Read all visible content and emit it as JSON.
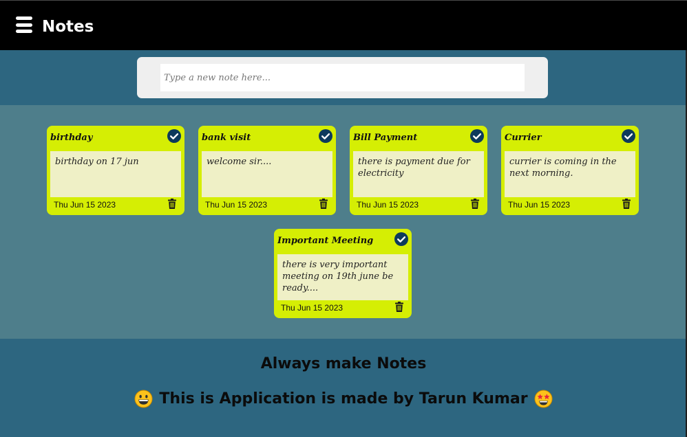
{
  "navbar": {
    "menu_icon": "hamburger-menu-icon",
    "title": "Notes"
  },
  "compose": {
    "placeholder": "Type a new note here...",
    "value": ""
  },
  "notes": [
    {
      "title": "birthday",
      "body": "birthday on 17 jun",
      "date": "Thu Jun 15 2023",
      "done_icon": "check-circle-icon",
      "delete_icon": "trash-icon"
    },
    {
      "title": "bank visit",
      "body": "welcome sir....",
      "date": "Thu Jun 15 2023",
      "done_icon": "check-circle-icon",
      "delete_icon": "trash-icon"
    },
    {
      "title": "Bill Payment",
      "body": "there is payment due for electricity",
      "date": "Thu Jun 15 2023",
      "done_icon": "check-circle-icon",
      "delete_icon": "trash-icon"
    },
    {
      "title": "Currier",
      "body": "currier is coming in the next morning.",
      "date": "Thu Jun 15 2023",
      "done_icon": "check-circle-icon",
      "delete_icon": "trash-icon"
    },
    {
      "title": "Important Meeting",
      "body": "there is very important meeting on 19th june be ready....",
      "date": "Thu Jun 15 2023",
      "done_icon": "check-circle-icon",
      "delete_icon": "trash-icon"
    }
  ],
  "footer": {
    "tagline": "Always make Notes",
    "credit": "This is Application is made by Tarun Kumar",
    "left_emoji": "grinning-face-icon",
    "right_emoji": "star-struck-face-icon"
  },
  "colors": {
    "navbar_bg": "#000000",
    "page_bg": "#2d6680",
    "notes_area_bg": "#4e7e8b",
    "note_card_bg": "#d5ee04",
    "note_body_bg": "#eff0c6",
    "check_icon": "#0d3a5c"
  }
}
